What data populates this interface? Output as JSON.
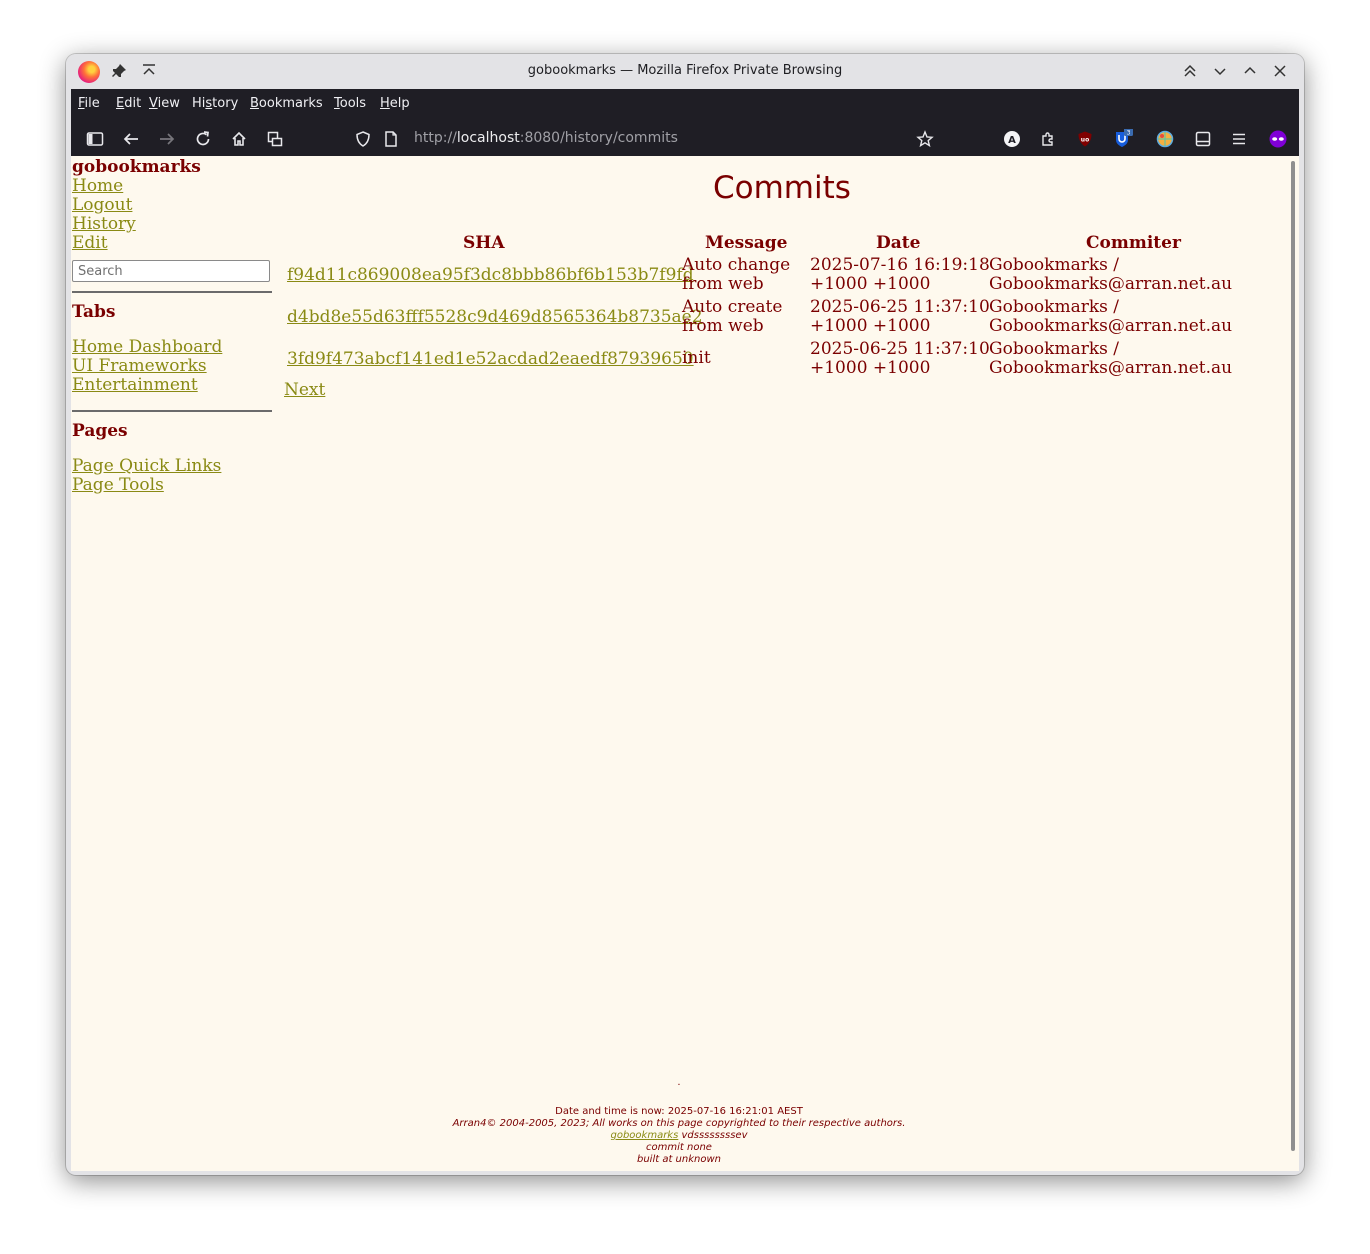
{
  "window": {
    "title": "gobookmarks — Mozilla Firefox Private Browsing"
  },
  "menu": [
    {
      "pre": "",
      "u": "F",
      "post": "ile"
    },
    {
      "pre": "",
      "u": "E",
      "post": "dit"
    },
    {
      "pre": "",
      "u": "V",
      "post": "iew"
    },
    {
      "pre": "Hi",
      "u": "s",
      "post": "tory"
    },
    {
      "pre": "",
      "u": "B",
      "post": "ookmarks"
    },
    {
      "pre": "",
      "u": "T",
      "post": "ools"
    },
    {
      "pre": "",
      "u": "H",
      "post": "elp"
    }
  ],
  "urlbar": {
    "scheme": "http://",
    "host": "localhost",
    "rest": ":8080/history/commits"
  },
  "extension_badge": "3",
  "sidebar": {
    "brand": "gobookmarks",
    "links": [
      "Home",
      "Logout",
      "History",
      "Edit"
    ],
    "search_placeholder": "Search",
    "tabs_title": "Tabs",
    "tabs": [
      "Home Dashboard",
      "UI Frameworks",
      "Entertainment"
    ],
    "pages_title": "Pages",
    "pages": [
      "Page Quick Links",
      "Page Tools"
    ]
  },
  "main": {
    "title": "Commits",
    "columns": [
      "SHA",
      "Message",
      "Date",
      "Commiter"
    ],
    "rows": [
      {
        "sha": "f94d11c869008ea95f3dc8bbb86bf6b153b7f9fd",
        "msg1": "Auto change",
        "msg2": "from web",
        "date1": "2025-07-16 16:19:18",
        "date2": "+1000 +1000",
        "by1": "Gobookmarks /",
        "by2": "Gobookmarks@arran.net.au"
      },
      {
        "sha": "d4bd8e55d63fff5528c9d469d8565364b8735ae2",
        "msg1": "Auto create",
        "msg2": "from web",
        "date1": "2025-06-25 11:37:10",
        "date2": "+1000 +1000",
        "by1": "Gobookmarks /",
        "by2": "Gobookmarks@arran.net.au"
      },
      {
        "sha": "3fd9f473abcf141ed1e52acdad2eaedf87939650",
        "msg1": "init",
        "msg2": "",
        "date1": "2025-06-25 11:37:10",
        "date2": "+1000 +1000",
        "by1": "Gobookmarks /",
        "by2": "Gobookmarks@arran.net.au"
      }
    ],
    "next_label": "Next"
  },
  "footer": {
    "dot": ".",
    "datetime": "Date and time is now: 2025-07-16 16:21:01 AEST",
    "copyright": "Arran4© 2004-2005, 2023; All works on this page copyrighted to their respective authors.",
    "app_link": "gobookmarks",
    "version": " vdssssssssev",
    "commit": "commit none",
    "built": "built at unknown"
  }
}
